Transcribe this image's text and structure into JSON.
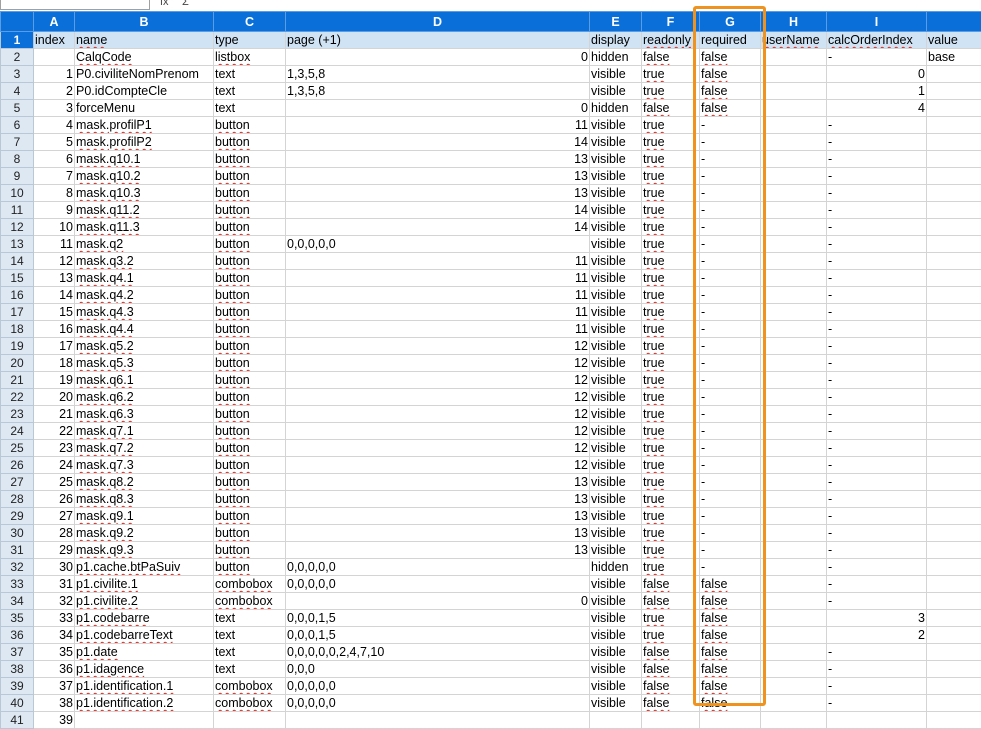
{
  "columns": [
    "A",
    "B",
    "C",
    "D",
    "E",
    "F",
    "G",
    "H",
    "I",
    ""
  ],
  "header_row": {
    "row_num": "1",
    "cells": [
      "index",
      "name",
      "type",
      "page (+1)",
      "display",
      "readonly",
      "required",
      "userName",
      "calcOrderIndex",
      "value"
    ]
  },
  "rows": [
    {
      "row_num": "2",
      "cells": [
        "",
        "CalqCode",
        "listbox",
        "0",
        "hidden",
        "false",
        "false",
        "",
        "-",
        "base"
      ]
    },
    {
      "row_num": "3",
      "cells": [
        "1",
        "P0.civiliteNomPrenom",
        "text",
        "1,3,5,8",
        "visible",
        "true",
        "false",
        "",
        "0",
        ""
      ]
    },
    {
      "row_num": "4",
      "cells": [
        "2",
        "P0.idCompteCle",
        "text",
        "1,3,5,8",
        "visible",
        "true",
        "false",
        "",
        "1",
        ""
      ]
    },
    {
      "row_num": "5",
      "cells": [
        "3",
        "forceMenu",
        "text",
        "0",
        "hidden",
        "false",
        "false",
        "",
        "4",
        ""
      ]
    },
    {
      "row_num": "6",
      "cells": [
        "4",
        "mask.profilP1",
        "button",
        "11",
        "visible",
        "true",
        "-",
        "",
        "-",
        ""
      ]
    },
    {
      "row_num": "7",
      "cells": [
        "5",
        "mask.profilP2",
        "button",
        "14",
        "visible",
        "true",
        "-",
        "",
        "-",
        ""
      ]
    },
    {
      "row_num": "8",
      "cells": [
        "6",
        "mask.q10.1",
        "button",
        "13",
        "visible",
        "true",
        "-",
        "",
        "-",
        ""
      ]
    },
    {
      "row_num": "9",
      "cells": [
        "7",
        "mask.q10.2",
        "button",
        "13",
        "visible",
        "true",
        "-",
        "",
        "-",
        ""
      ]
    },
    {
      "row_num": "10",
      "cells": [
        "8",
        "mask.q10.3",
        "button",
        "13",
        "visible",
        "true",
        "-",
        "",
        "-",
        ""
      ]
    },
    {
      "row_num": "11",
      "cells": [
        "9",
        "mask.q11.2",
        "button",
        "14",
        "visible",
        "true",
        "-",
        "",
        "-",
        ""
      ]
    },
    {
      "row_num": "12",
      "cells": [
        "10",
        "mask.q11.3",
        "button",
        "14",
        "visible",
        "true",
        "-",
        "",
        "-",
        ""
      ]
    },
    {
      "row_num": "13",
      "cells": [
        "11",
        "mask.q2",
        "button",
        "0,0,0,0,0",
        "visible",
        "true",
        "-",
        "",
        "-",
        ""
      ]
    },
    {
      "row_num": "14",
      "cells": [
        "12",
        "mask.q3.2",
        "button",
        "11",
        "visible",
        "true",
        "-",
        "",
        "-",
        ""
      ]
    },
    {
      "row_num": "15",
      "cells": [
        "13",
        "mask.q4.1",
        "button",
        "11",
        "visible",
        "true",
        "-",
        "",
        "-",
        ""
      ]
    },
    {
      "row_num": "16",
      "cells": [
        "14",
        "mask.q4.2",
        "button",
        "11",
        "visible",
        "true",
        "-",
        "",
        "-",
        ""
      ]
    },
    {
      "row_num": "17",
      "cells": [
        "15",
        "mask.q4.3",
        "button",
        "11",
        "visible",
        "true",
        "-",
        "",
        "-",
        ""
      ]
    },
    {
      "row_num": "18",
      "cells": [
        "16",
        "mask.q4.4",
        "button",
        "11",
        "visible",
        "true",
        "-",
        "",
        "-",
        ""
      ]
    },
    {
      "row_num": "19",
      "cells": [
        "17",
        "mask.q5.2",
        "button",
        "12",
        "visible",
        "true",
        "-",
        "",
        "-",
        ""
      ]
    },
    {
      "row_num": "20",
      "cells": [
        "18",
        "mask.q5.3",
        "button",
        "12",
        "visible",
        "true",
        "-",
        "",
        "-",
        ""
      ]
    },
    {
      "row_num": "21",
      "cells": [
        "19",
        "mask.q6.1",
        "button",
        "12",
        "visible",
        "true",
        "-",
        "",
        "-",
        ""
      ]
    },
    {
      "row_num": "22",
      "cells": [
        "20",
        "mask.q6.2",
        "button",
        "12",
        "visible",
        "true",
        "-",
        "",
        "-",
        ""
      ]
    },
    {
      "row_num": "23",
      "cells": [
        "21",
        "mask.q6.3",
        "button",
        "12",
        "visible",
        "true",
        "-",
        "",
        "-",
        ""
      ]
    },
    {
      "row_num": "24",
      "cells": [
        "22",
        "mask.q7.1",
        "button",
        "12",
        "visible",
        "true",
        "-",
        "",
        "-",
        ""
      ]
    },
    {
      "row_num": "25",
      "cells": [
        "23",
        "mask.q7.2",
        "button",
        "12",
        "visible",
        "true",
        "-",
        "",
        "-",
        ""
      ]
    },
    {
      "row_num": "26",
      "cells": [
        "24",
        "mask.q7.3",
        "button",
        "12",
        "visible",
        "true",
        "-",
        "",
        "-",
        ""
      ]
    },
    {
      "row_num": "27",
      "cells": [
        "25",
        "mask.q8.2",
        "button",
        "13",
        "visible",
        "true",
        "-",
        "",
        "-",
        ""
      ]
    },
    {
      "row_num": "28",
      "cells": [
        "26",
        "mask.q8.3",
        "button",
        "13",
        "visible",
        "true",
        "-",
        "",
        "-",
        ""
      ]
    },
    {
      "row_num": "29",
      "cells": [
        "27",
        "mask.q9.1",
        "button",
        "13",
        "visible",
        "true",
        "-",
        "",
        "-",
        ""
      ]
    },
    {
      "row_num": "30",
      "cells": [
        "28",
        "mask.q9.2",
        "button",
        "13",
        "visible",
        "true",
        "-",
        "",
        "-",
        ""
      ]
    },
    {
      "row_num": "31",
      "cells": [
        "29",
        "mask.q9.3",
        "button",
        "13",
        "visible",
        "true",
        "-",
        "",
        "-",
        ""
      ]
    },
    {
      "row_num": "32",
      "cells": [
        "30",
        "p1.cache.btPaSuiv",
        "button",
        "0,0,0,0,0",
        "hidden",
        "true",
        "-",
        "",
        "-",
        ""
      ]
    },
    {
      "row_num": "33",
      "cells": [
        "31",
        "p1.civilite.1",
        "combobox",
        "0,0,0,0,0",
        "visible",
        "false",
        "false",
        "",
        "-",
        ""
      ]
    },
    {
      "row_num": "34",
      "cells": [
        "32",
        "p1.civilite.2",
        "combobox",
        "0",
        "visible",
        "false",
        "false",
        "",
        "-",
        ""
      ]
    },
    {
      "row_num": "35",
      "cells": [
        "33",
        "p1.codebarre",
        "text",
        "0,0,0,1,5",
        "visible",
        "true",
        "false",
        "",
        "3",
        ""
      ]
    },
    {
      "row_num": "36",
      "cells": [
        "34",
        "p1.codebarreText",
        "text",
        "0,0,0,1,5",
        "visible",
        "true",
        "false",
        "",
        "2",
        ""
      ]
    },
    {
      "row_num": "37",
      "cells": [
        "35",
        "p1.date",
        "text",
        "0,0,0,0,0,2,4,7,10",
        "visible",
        "false",
        "false",
        "",
        "-",
        ""
      ]
    },
    {
      "row_num": "38",
      "cells": [
        "36",
        "p1.idagence",
        "text",
        "0,0,0",
        "visible",
        "false",
        "false",
        "",
        "-",
        ""
      ]
    },
    {
      "row_num": "39",
      "cells": [
        "37",
        "p1.identification.1",
        "combobox",
        "0,0,0,0,0",
        "visible",
        "false",
        "false",
        "",
        "-",
        ""
      ]
    },
    {
      "row_num": "40",
      "cells": [
        "38",
        "p1.identification.2",
        "combobox",
        "0,0,0,0,0",
        "visible",
        "false",
        "false",
        "",
        "-",
        ""
      ]
    },
    {
      "row_num": "41",
      "cells": [
        "39",
        "",
        "",
        "",
        "",
        "",
        "",
        "",
        "",
        ""
      ]
    }
  ],
  "formula_bar": {
    "fx_icon": "fx",
    "sigma_icon": "Σ"
  },
  "colors": {
    "header_blue": "#0a6fd8",
    "row_header_bg": "#dde8f3",
    "highlight_orange": "#f0921e",
    "spell_underline": "#e0261a"
  }
}
